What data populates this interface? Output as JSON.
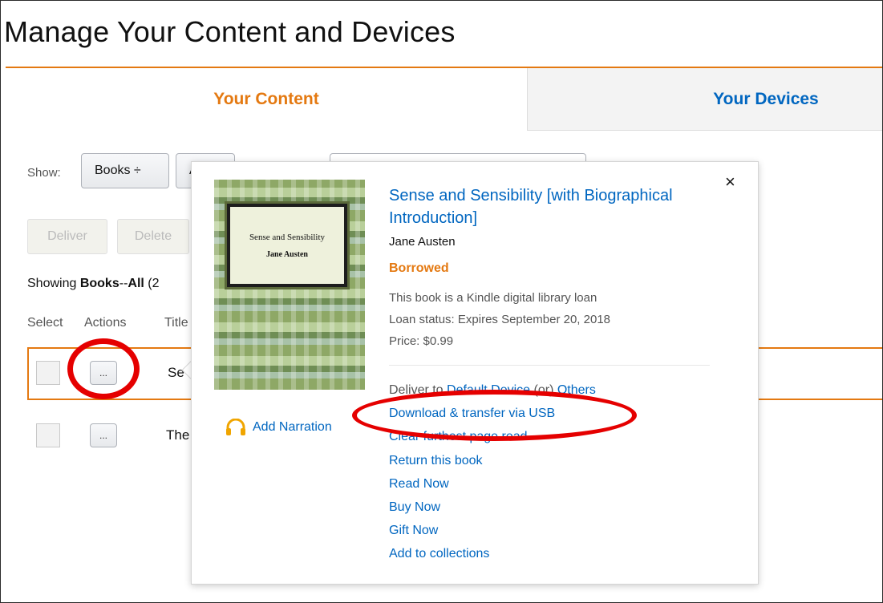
{
  "page": {
    "title": "Manage Your Content and Devices"
  },
  "tabs": {
    "content": "Your Content",
    "devices": "Your Devices"
  },
  "filters": {
    "show_label": "Show:",
    "category": "Books ÷",
    "sort_fragment": "A"
  },
  "toolbar": {
    "deliver": "Deliver",
    "delete": "Delete"
  },
  "summary": {
    "prefix": "Showing ",
    "category": "Books",
    "sep": "--",
    "filter": "All",
    "count_fragment": " (2"
  },
  "columns": {
    "select": "Select",
    "actions": "Actions",
    "title_fragment": "Title"
  },
  "rows": [
    {
      "title_fragment": "Se",
      "actions_label": "..."
    },
    {
      "title_fragment": "The",
      "actions_label": "..."
    }
  ],
  "popover": {
    "close": "×",
    "cover": {
      "title": "Sense and Sensibility",
      "author": "Jane Austen"
    },
    "narration": "Add Narration",
    "book_title": "Sense and Sensibility [with Biographical Introduction]",
    "author": "Jane Austen",
    "status": "Borrowed",
    "info": {
      "loan_note": "This book is a Kindle digital library loan",
      "loan_status": "Loan status: Expires  September 20, 2018",
      "price": "Price:  $0.99"
    },
    "deliver": {
      "prefix": "Deliver to ",
      "device": "Default Device",
      "or": " (or) ",
      "others": "Others"
    },
    "actions": [
      "Download & transfer via USB",
      "Clear furthest page read",
      "Return this book",
      "Read Now",
      "Buy Now",
      "Gift Now",
      "Add to collections"
    ]
  },
  "colors": {
    "accent_orange": "#e47911",
    "link_blue": "#0066c0",
    "annotation_red": "#e50000"
  }
}
